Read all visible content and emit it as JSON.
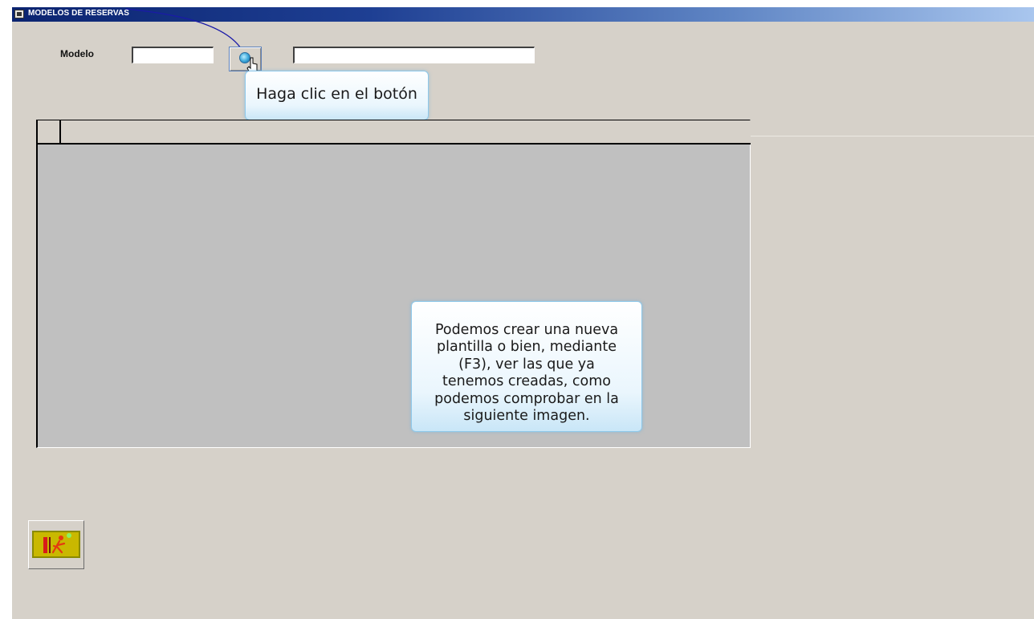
{
  "window": {
    "title": "MODELOS DE RESERVAS",
    "icon": "window-icon"
  },
  "form": {
    "modelo_label": "Modelo",
    "modelo_value": "",
    "descripcion_value": "",
    "lookup_button_icon": "search-lookup-icon"
  },
  "tooltips": {
    "click_hint": "Haga clic en el botón",
    "info": "Podemos crear una nueva\nplantilla o bien, mediante\n(F3), ver las que ya\ntenemos  creadas, como\npodemos comprobar en la\nsiguiente imagen."
  },
  "grid": {
    "columns": [],
    "rows": []
  },
  "footer": {
    "exit_button_icon": "exit-door-icon"
  },
  "colors": {
    "title_bar_start": "#0b2470",
    "title_bar_end": "#a9c6ee",
    "background": "#d6d1c9",
    "grid_area": "#c0c0c0",
    "callout_border": "#8ec8ea",
    "connector_line": "#1a1aa8"
  }
}
